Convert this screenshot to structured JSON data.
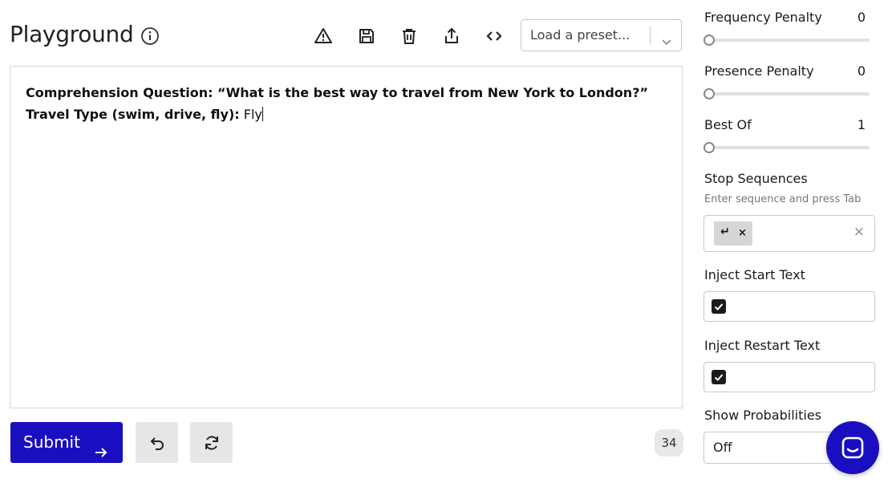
{
  "header": {
    "title": "Playground",
    "preset_placeholder": "Load a preset..."
  },
  "toolbar_icons": [
    "warning-icon",
    "save-icon",
    "trash-icon",
    "share-icon",
    "code-icon"
  ],
  "editor": {
    "line1_bold": "Comprehension Question: “What is the best way to travel from New York to London?”",
    "line2_bold": "Travel Type (swim, drive, fly):",
    "line2_text": " Fly"
  },
  "actions": {
    "submit_label": "Submit",
    "token_count": "34"
  },
  "params": {
    "frequency_penalty": {
      "label": "Frequency Penalty",
      "value": "0"
    },
    "presence_penalty": {
      "label": "Presence Penalty",
      "value": "0"
    },
    "best_of": {
      "label": "Best Of",
      "value": "1"
    }
  },
  "stop_sequences": {
    "label": "Stop Sequences",
    "hint": "Enter sequence and press Tab",
    "chip_glyph": "↵",
    "chip_remove": "×",
    "clear": "×"
  },
  "inject_start": {
    "label": "Inject Start Text",
    "checked": true
  },
  "inject_restart": {
    "label": "Inject Restart Text",
    "checked": true
  },
  "show_probabilities": {
    "label": "Show Probabilities",
    "value": "Off"
  },
  "colors": {
    "accent": "#1a0fc0",
    "chip": "#d6d6d6",
    "button_gray": "#e6e6e6"
  }
}
